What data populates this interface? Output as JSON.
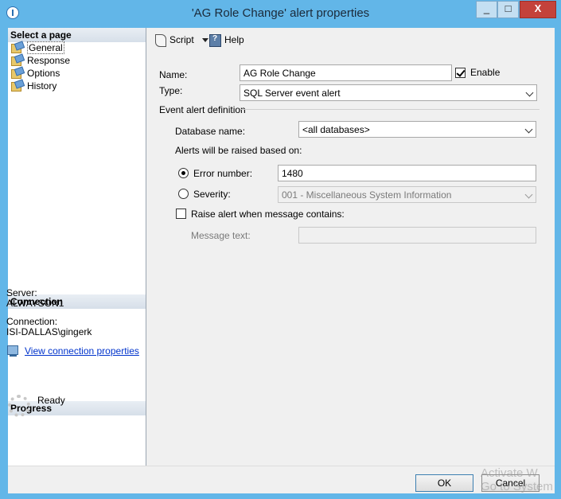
{
  "window": {
    "title": "'AG Role Change' alert properties",
    "minimize_glyph": "_",
    "maximize_glyph": "□",
    "close_glyph": "X"
  },
  "left": {
    "select_page_header": "Select a page",
    "pages": [
      {
        "label": "General",
        "icon": "page-icon",
        "selected": true
      },
      {
        "label": "Response",
        "icon": "page-icon",
        "selected": false
      },
      {
        "label": "Options",
        "icon": "page-icon",
        "selected": false
      },
      {
        "label": "History",
        "icon": "page-icon",
        "selected": false
      }
    ],
    "connection_header": "Connection",
    "server_label": "Server:",
    "server_value": "ALWAYSON1",
    "connection_label": "Connection:",
    "connection_value": "ISI-DALLAS\\gingerk",
    "view_connection_link": "View connection properties",
    "progress_header": "Progress",
    "progress_status": "Ready"
  },
  "toolbar": {
    "script_label": "Script",
    "help_label": "Help"
  },
  "form": {
    "name_label": "Name:",
    "name_value": "AG Role Change",
    "enable_label": "Enable",
    "enable_checked": true,
    "type_label": "Type:",
    "type_value": "SQL Server event alert",
    "definition_header": "Event alert definition",
    "database_label": "Database name:",
    "database_value": "<all databases>",
    "raised_based_on_label": "Alerts will be raised based on:",
    "error_number_label": "Error number:",
    "error_number_value": "1480",
    "error_number_selected": true,
    "severity_label": "Severity:",
    "severity_value": "001 - Miscellaneous System Information",
    "severity_selected": false,
    "raise_message_label": "Raise alert when message contains:",
    "raise_message_checked": false,
    "message_text_label": "Message text:",
    "message_text_value": ""
  },
  "buttons": {
    "ok": "OK",
    "cancel": "Cancel"
  },
  "watermark": {
    "line1": "Activate W",
    "line2": "Go to System"
  }
}
